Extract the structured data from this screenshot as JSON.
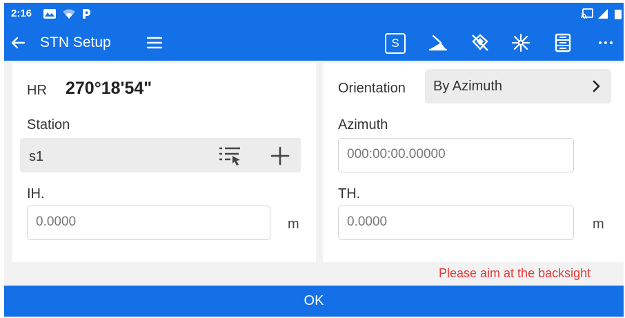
{
  "status": {
    "time": "2:16"
  },
  "appbar": {
    "title": "STN Setup",
    "s_label": "S"
  },
  "left": {
    "hr_label": "HR",
    "hr_value": "270°18'54\"",
    "station_label": "Station",
    "station_value": "s1",
    "ih_label": "IH.",
    "ih_placeholder": "0.0000",
    "ih_unit": "m"
  },
  "right": {
    "orientation_label": "Orientation",
    "orientation_value": "By Azimuth",
    "azimuth_label": "Azimuth",
    "azimuth_placeholder": "000:00:00.00000",
    "th_label": "TH.",
    "th_placeholder": "0.0000",
    "th_unit": "m"
  },
  "warning": "Please aim at the backsight",
  "ok_label": "OK",
  "colors": {
    "primary": "#1470e6",
    "warning": "#e53935"
  }
}
